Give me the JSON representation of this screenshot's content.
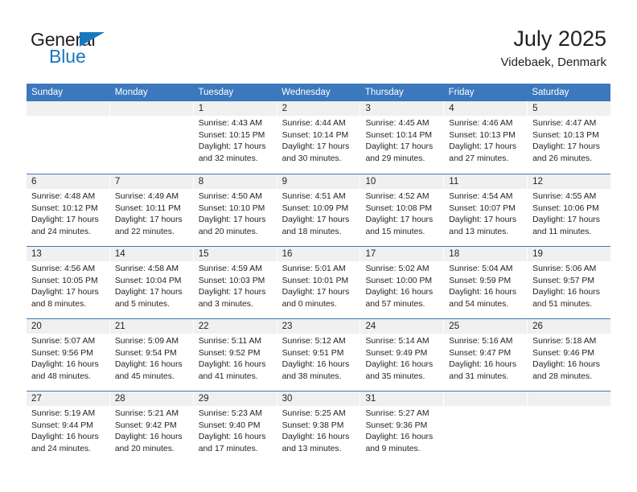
{
  "brand": {
    "name_part1": "General",
    "name_part2": "Blue",
    "flag_color": "#1878be"
  },
  "header": {
    "title": "July 2025",
    "subtitle": "Videbaek, Denmark"
  },
  "calendar": {
    "header_color": "#3b78bd",
    "weekdays": [
      "Sunday",
      "Monday",
      "Tuesday",
      "Wednesday",
      "Thursday",
      "Friday",
      "Saturday"
    ],
    "weeks": [
      [
        {
          "day": "",
          "lines": []
        },
        {
          "day": "",
          "lines": []
        },
        {
          "day": "1",
          "lines": [
            "Sunrise: 4:43 AM",
            "Sunset: 10:15 PM",
            "Daylight: 17 hours",
            "and 32 minutes."
          ]
        },
        {
          "day": "2",
          "lines": [
            "Sunrise: 4:44 AM",
            "Sunset: 10:14 PM",
            "Daylight: 17 hours",
            "and 30 minutes."
          ]
        },
        {
          "day": "3",
          "lines": [
            "Sunrise: 4:45 AM",
            "Sunset: 10:14 PM",
            "Daylight: 17 hours",
            "and 29 minutes."
          ]
        },
        {
          "day": "4",
          "lines": [
            "Sunrise: 4:46 AM",
            "Sunset: 10:13 PM",
            "Daylight: 17 hours",
            "and 27 minutes."
          ]
        },
        {
          "day": "5",
          "lines": [
            "Sunrise: 4:47 AM",
            "Sunset: 10:13 PM",
            "Daylight: 17 hours",
            "and 26 minutes."
          ]
        }
      ],
      [
        {
          "day": "6",
          "lines": [
            "Sunrise: 4:48 AM",
            "Sunset: 10:12 PM",
            "Daylight: 17 hours",
            "and 24 minutes."
          ]
        },
        {
          "day": "7",
          "lines": [
            "Sunrise: 4:49 AM",
            "Sunset: 10:11 PM",
            "Daylight: 17 hours",
            "and 22 minutes."
          ]
        },
        {
          "day": "8",
          "lines": [
            "Sunrise: 4:50 AM",
            "Sunset: 10:10 PM",
            "Daylight: 17 hours",
            "and 20 minutes."
          ]
        },
        {
          "day": "9",
          "lines": [
            "Sunrise: 4:51 AM",
            "Sunset: 10:09 PM",
            "Daylight: 17 hours",
            "and 18 minutes."
          ]
        },
        {
          "day": "10",
          "lines": [
            "Sunrise: 4:52 AM",
            "Sunset: 10:08 PM",
            "Daylight: 17 hours",
            "and 15 minutes."
          ]
        },
        {
          "day": "11",
          "lines": [
            "Sunrise: 4:54 AM",
            "Sunset: 10:07 PM",
            "Daylight: 17 hours",
            "and 13 minutes."
          ]
        },
        {
          "day": "12",
          "lines": [
            "Sunrise: 4:55 AM",
            "Sunset: 10:06 PM",
            "Daylight: 17 hours",
            "and 11 minutes."
          ]
        }
      ],
      [
        {
          "day": "13",
          "lines": [
            "Sunrise: 4:56 AM",
            "Sunset: 10:05 PM",
            "Daylight: 17 hours",
            "and 8 minutes."
          ]
        },
        {
          "day": "14",
          "lines": [
            "Sunrise: 4:58 AM",
            "Sunset: 10:04 PM",
            "Daylight: 17 hours",
            "and 5 minutes."
          ]
        },
        {
          "day": "15",
          "lines": [
            "Sunrise: 4:59 AM",
            "Sunset: 10:03 PM",
            "Daylight: 17 hours",
            "and 3 minutes."
          ]
        },
        {
          "day": "16",
          "lines": [
            "Sunrise: 5:01 AM",
            "Sunset: 10:01 PM",
            "Daylight: 17 hours",
            "and 0 minutes."
          ]
        },
        {
          "day": "17",
          "lines": [
            "Sunrise: 5:02 AM",
            "Sunset: 10:00 PM",
            "Daylight: 16 hours",
            "and 57 minutes."
          ]
        },
        {
          "day": "18",
          "lines": [
            "Sunrise: 5:04 AM",
            "Sunset: 9:59 PM",
            "Daylight: 16 hours",
            "and 54 minutes."
          ]
        },
        {
          "day": "19",
          "lines": [
            "Sunrise: 5:06 AM",
            "Sunset: 9:57 PM",
            "Daylight: 16 hours",
            "and 51 minutes."
          ]
        }
      ],
      [
        {
          "day": "20",
          "lines": [
            "Sunrise: 5:07 AM",
            "Sunset: 9:56 PM",
            "Daylight: 16 hours",
            "and 48 minutes."
          ]
        },
        {
          "day": "21",
          "lines": [
            "Sunrise: 5:09 AM",
            "Sunset: 9:54 PM",
            "Daylight: 16 hours",
            "and 45 minutes."
          ]
        },
        {
          "day": "22",
          "lines": [
            "Sunrise: 5:11 AM",
            "Sunset: 9:52 PM",
            "Daylight: 16 hours",
            "and 41 minutes."
          ]
        },
        {
          "day": "23",
          "lines": [
            "Sunrise: 5:12 AM",
            "Sunset: 9:51 PM",
            "Daylight: 16 hours",
            "and 38 minutes."
          ]
        },
        {
          "day": "24",
          "lines": [
            "Sunrise: 5:14 AM",
            "Sunset: 9:49 PM",
            "Daylight: 16 hours",
            "and 35 minutes."
          ]
        },
        {
          "day": "25",
          "lines": [
            "Sunrise: 5:16 AM",
            "Sunset: 9:47 PM",
            "Daylight: 16 hours",
            "and 31 minutes."
          ]
        },
        {
          "day": "26",
          "lines": [
            "Sunrise: 5:18 AM",
            "Sunset: 9:46 PM",
            "Daylight: 16 hours",
            "and 28 minutes."
          ]
        }
      ],
      [
        {
          "day": "27",
          "lines": [
            "Sunrise: 5:19 AM",
            "Sunset: 9:44 PM",
            "Daylight: 16 hours",
            "and 24 minutes."
          ]
        },
        {
          "day": "28",
          "lines": [
            "Sunrise: 5:21 AM",
            "Sunset: 9:42 PM",
            "Daylight: 16 hours",
            "and 20 minutes."
          ]
        },
        {
          "day": "29",
          "lines": [
            "Sunrise: 5:23 AM",
            "Sunset: 9:40 PM",
            "Daylight: 16 hours",
            "and 17 minutes."
          ]
        },
        {
          "day": "30",
          "lines": [
            "Sunrise: 5:25 AM",
            "Sunset: 9:38 PM",
            "Daylight: 16 hours",
            "and 13 minutes."
          ]
        },
        {
          "day": "31",
          "lines": [
            "Sunrise: 5:27 AM",
            "Sunset: 9:36 PM",
            "Daylight: 16 hours",
            "and 9 minutes."
          ]
        },
        {
          "day": "",
          "lines": []
        },
        {
          "day": "",
          "lines": []
        }
      ]
    ]
  }
}
